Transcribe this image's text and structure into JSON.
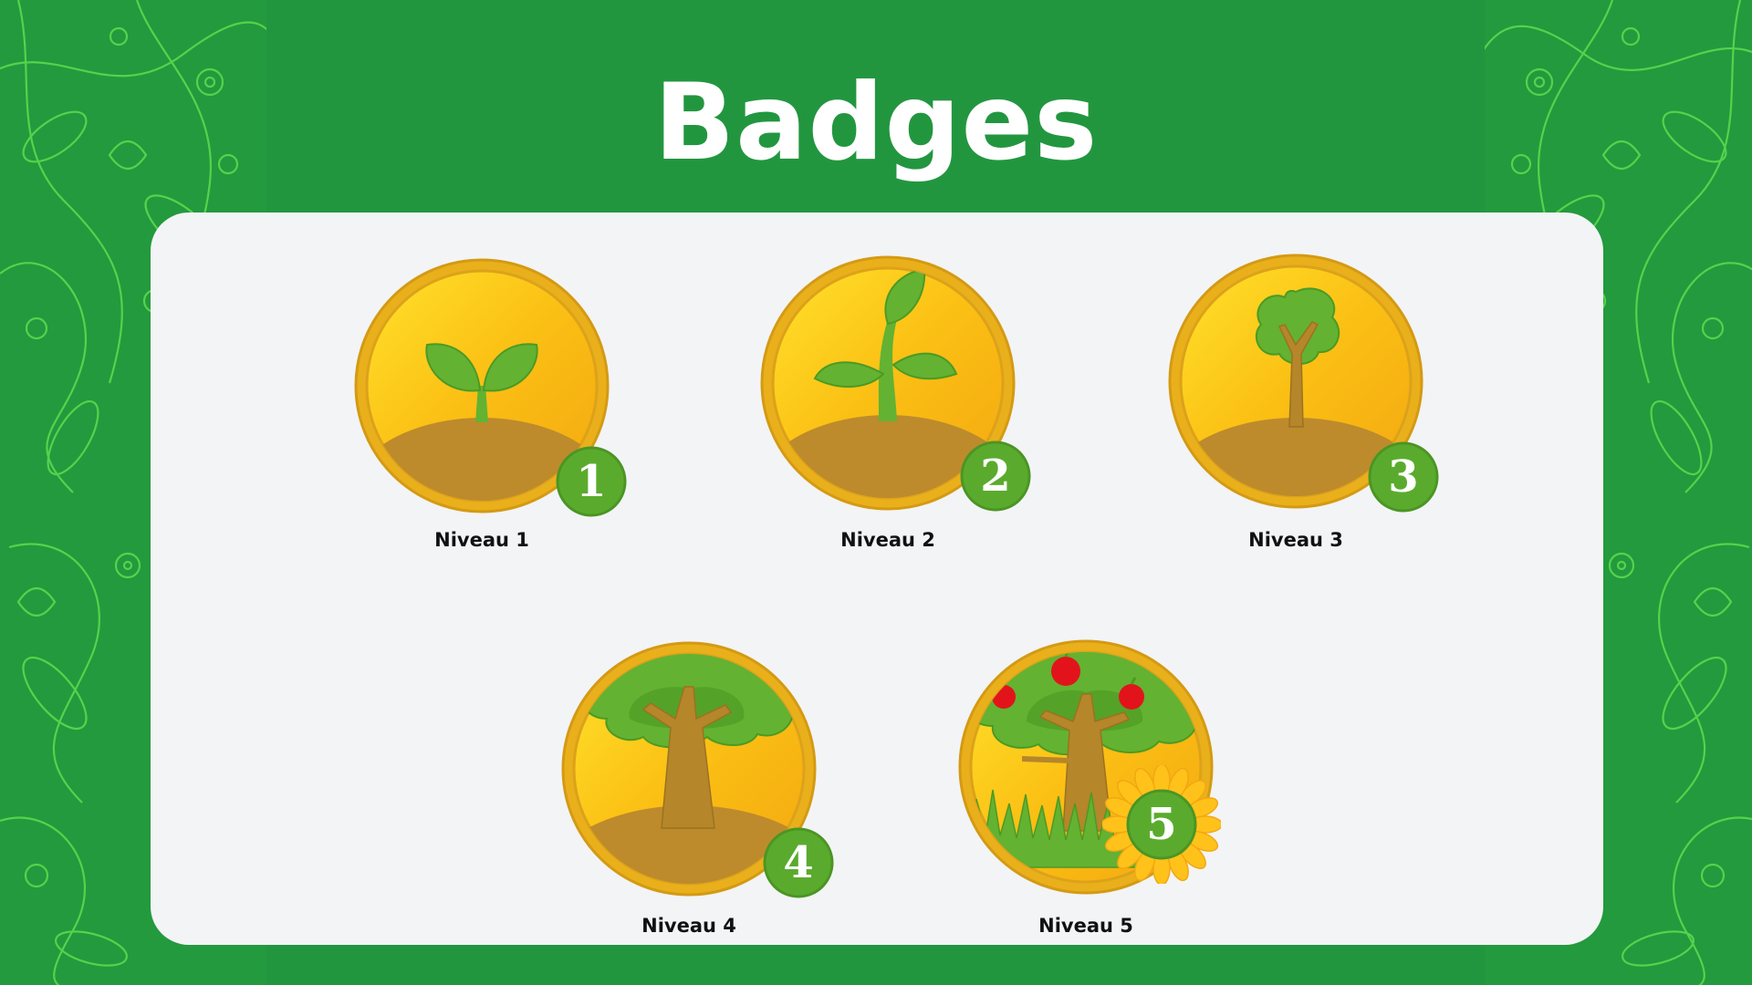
{
  "page": {
    "title": "Badges"
  },
  "colors": {
    "background_green": "#22963f",
    "pattern_line": "#5fdc4f",
    "panel": "#f3f4f6",
    "coin_gold": "#fbbf14",
    "coin_rim": "#e0a51a",
    "soil": "#bd8b2c",
    "leaf_green": "#63b232",
    "number_circle": "#5aab2d",
    "apple_red": "#e3131b"
  },
  "badges": [
    {
      "label": "Niveau 1",
      "number": "1",
      "icon": "sprout-icon"
    },
    {
      "label": "Niveau 2",
      "number": "2",
      "icon": "seedling-icon"
    },
    {
      "label": "Niveau 3",
      "number": "3",
      "icon": "young-tree-icon"
    },
    {
      "label": "Niveau 4",
      "number": "4",
      "icon": "tree-icon"
    },
    {
      "label": "Niveau 5",
      "number": "5",
      "icon": "apple-tree-icon"
    }
  ]
}
